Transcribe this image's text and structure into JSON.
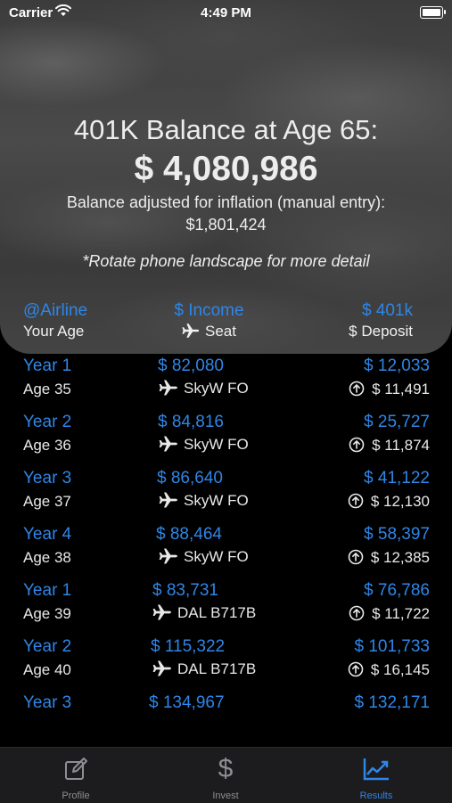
{
  "status_bar": {
    "carrier": "Carrier",
    "time": "4:49 PM"
  },
  "header": {
    "title": "401K Balance at Age 65:",
    "balance": "$ 4,080,986",
    "adjusted_label": "Balance adjusted for inflation (manual entry):",
    "adjusted_value": "$1,801,424",
    "rotate_hint": "*Rotate phone landscape for more detail"
  },
  "columns": {
    "airline": "@Airline",
    "your_age": "Your Age",
    "income": "$ Income",
    "seat": "Seat",
    "k401": "$ 401k",
    "deposit": "$ Deposit"
  },
  "rows": [
    {
      "year": "Year 1",
      "age": "Age 35",
      "income": "$ 82,080",
      "seat": "SkyW FO",
      "balance": "$ 12,033",
      "deposit": "$ 11,491"
    },
    {
      "year": "Year 2",
      "age": "Age 36",
      "income": "$ 84,816",
      "seat": "SkyW FO",
      "balance": "$ 25,727",
      "deposit": "$ 11,874"
    },
    {
      "year": "Year 3",
      "age": "Age 37",
      "income": "$ 86,640",
      "seat": "SkyW FO",
      "balance": "$ 41,122",
      "deposit": "$ 12,130"
    },
    {
      "year": "Year 4",
      "age": "Age 38",
      "income": "$ 88,464",
      "seat": "SkyW FO",
      "balance": "$ 58,397",
      "deposit": "$ 12,385"
    },
    {
      "year": "Year 1",
      "age": "Age 39",
      "income": "$ 83,731",
      "seat": "DAL B717B",
      "balance": "$ 76,786",
      "deposit": "$ 11,722"
    },
    {
      "year": "Year 2",
      "age": "Age 40",
      "income": "$ 115,322",
      "seat": "DAL B717B",
      "balance": "$ 101,733",
      "deposit": "$ 16,145"
    },
    {
      "year": "Year 3",
      "age": "",
      "income": "$ 134,967",
      "seat": "",
      "balance": "$ 132,171",
      "deposit": ""
    }
  ],
  "tabs": [
    {
      "label": "Profile",
      "icon": "edit-icon"
    },
    {
      "label": "Invest",
      "icon": "dollar-icon"
    },
    {
      "label": "Results",
      "icon": "chart-icon",
      "active": true
    }
  ],
  "colors": {
    "accent": "#2f86e6",
    "tabbar": "#1c1c1e",
    "inactive": "#8e8e93"
  }
}
